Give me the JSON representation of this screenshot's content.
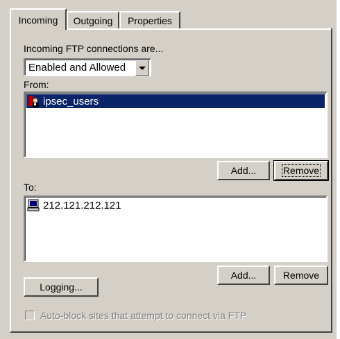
{
  "tabs": [
    {
      "label": "Incoming",
      "active": true
    },
    {
      "label": "Outgoing",
      "active": false
    },
    {
      "label": "Properties",
      "active": false
    }
  ],
  "incoming": {
    "heading": "Incoming FTP connections are...",
    "mode_selected": "Enabled and Allowed"
  },
  "from": {
    "label": "From:",
    "items": [
      {
        "icon": "user-group-icon",
        "text": "ipsec_users",
        "selected": true
      }
    ],
    "add_label": "Add...",
    "remove_label": "Remove"
  },
  "to": {
    "label": "To:",
    "items": [
      {
        "icon": "computer-icon",
        "text": "212.121.212.121",
        "selected": false
      }
    ],
    "add_label": "Add...",
    "remove_label": "Remove"
  },
  "logging_label": "Logging...",
  "autoblock": {
    "label": "Auto-block sites that attempt to connect via FTP",
    "checked": false,
    "enabled": false
  },
  "colors": {
    "face": "#d4d0c8",
    "selection": "#0a246a",
    "disabled_text": "#808080"
  }
}
